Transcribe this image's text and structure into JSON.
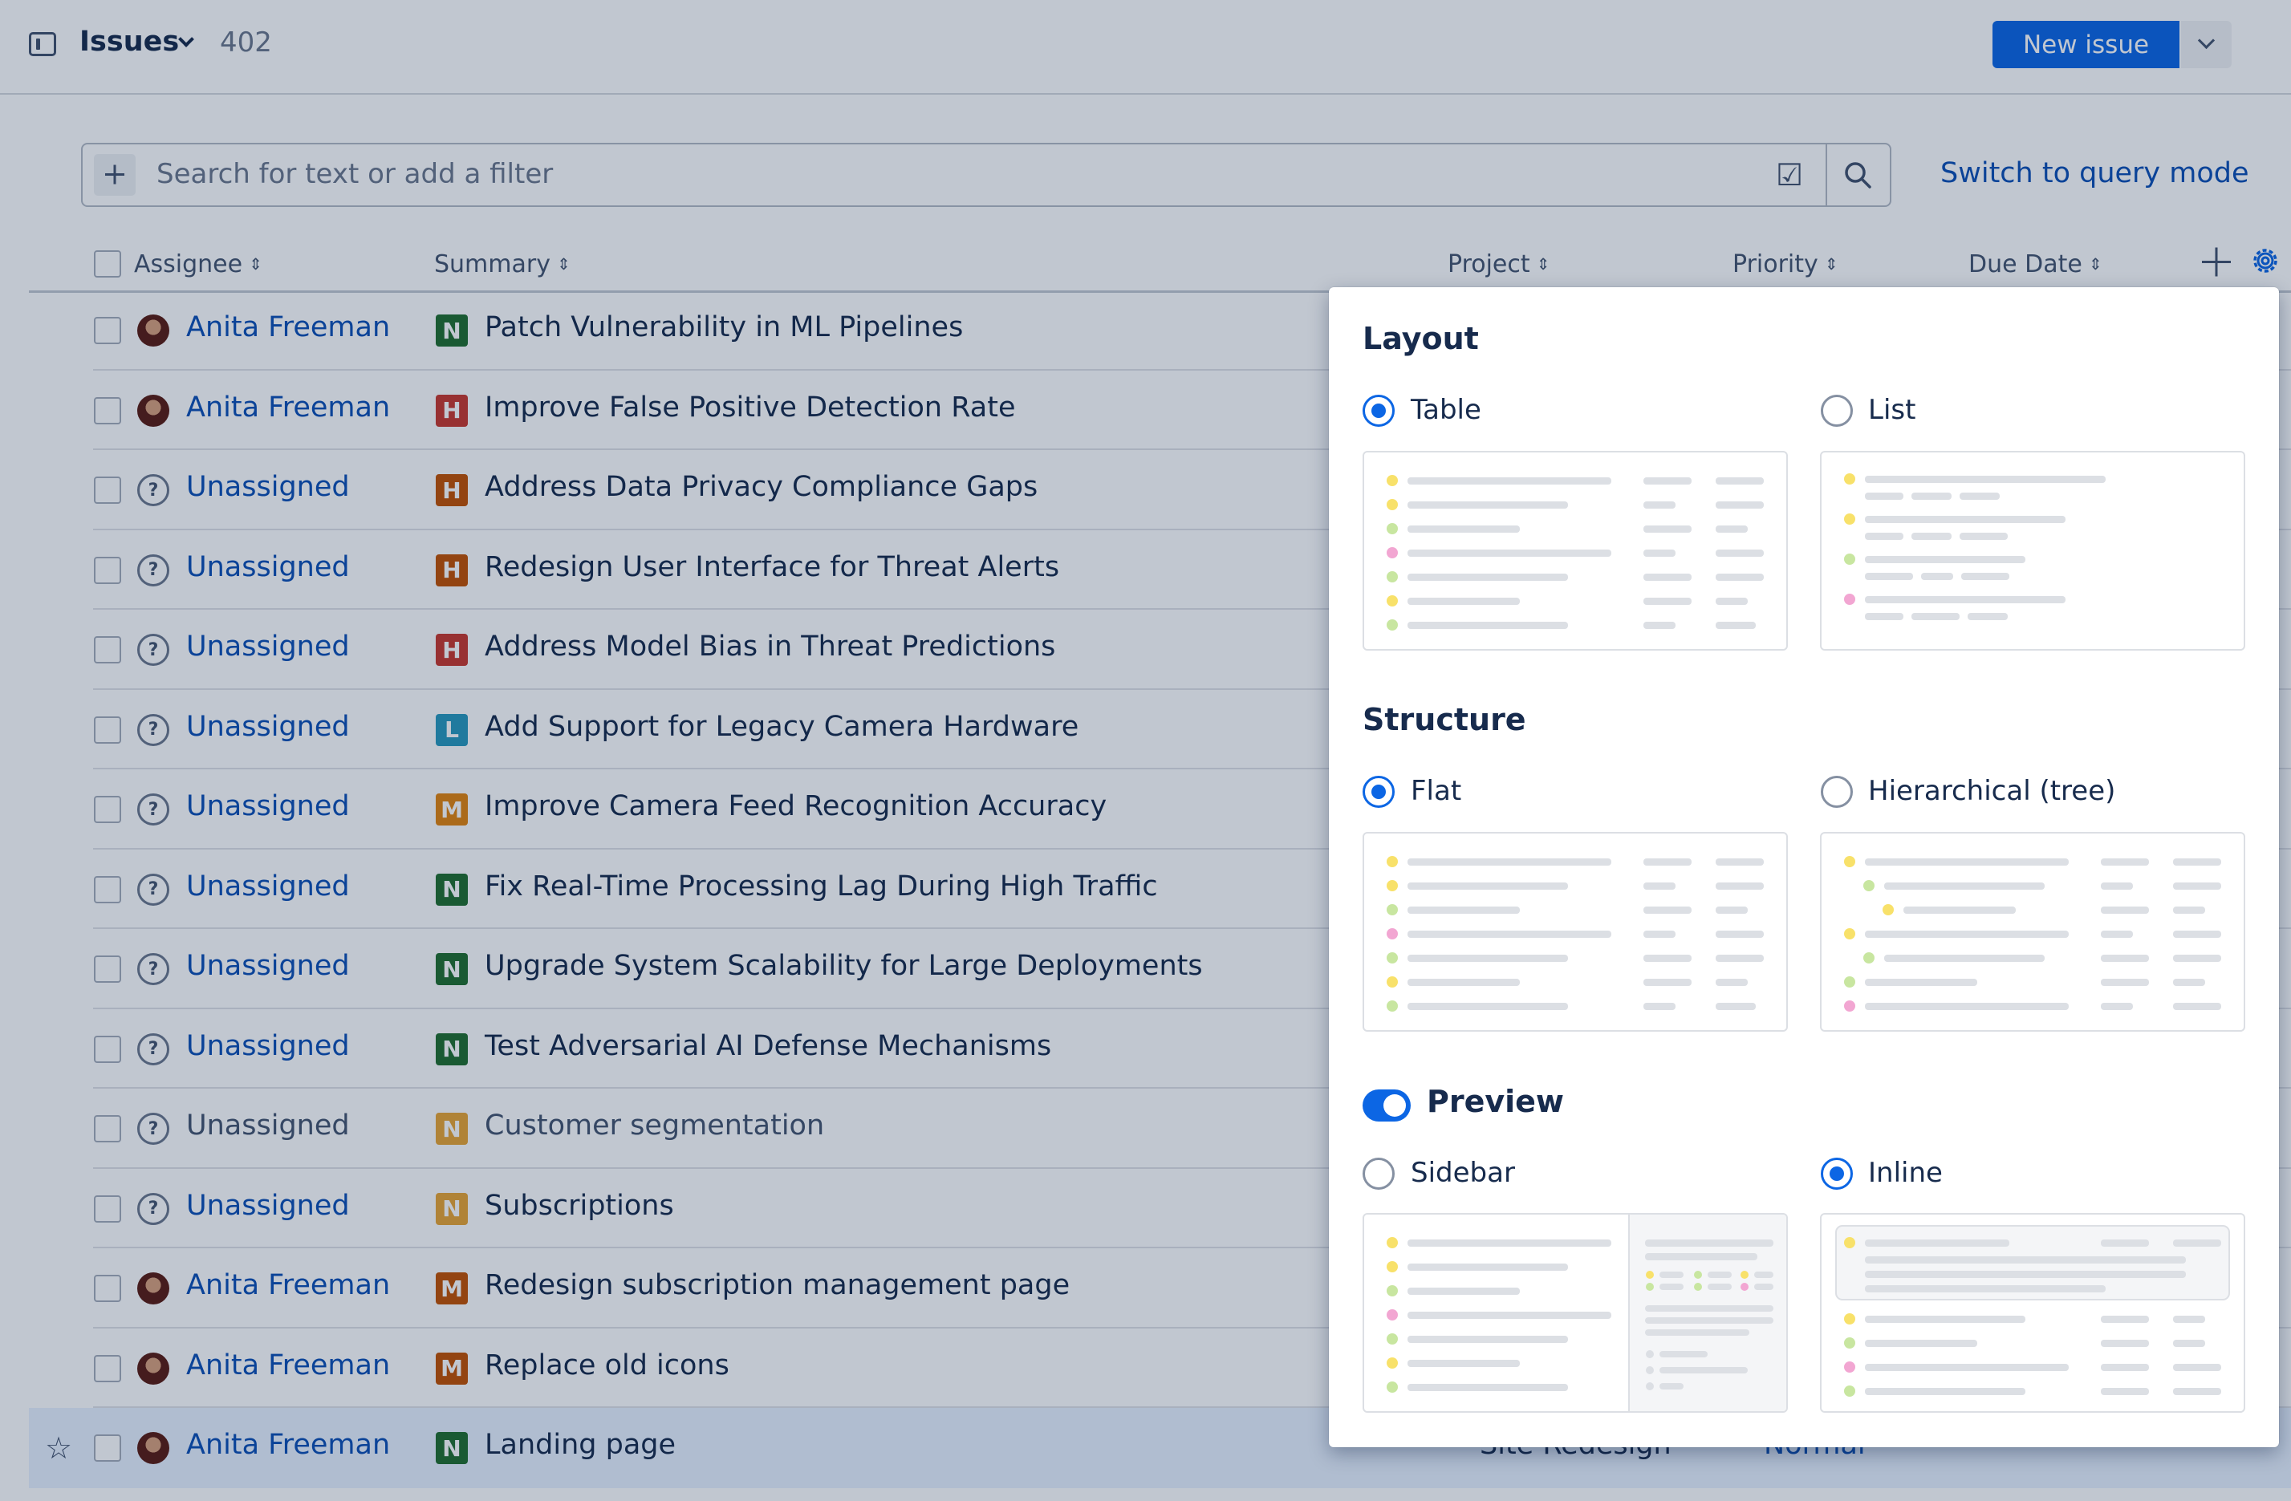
{
  "header": {
    "title": "Issues",
    "count": "402",
    "new_issue_label": "New issue"
  },
  "search": {
    "placeholder": "Search for text or add a filter",
    "switch_label": "Switch to query mode"
  },
  "columns": {
    "assignee": "Assignee",
    "summary": "Summary",
    "project": "Project",
    "priority": "Priority",
    "due_date": "Due Date"
  },
  "rows": [
    {
      "assignee": "Anita Freeman",
      "avatar": "person",
      "priority_letter": "N",
      "priority_color": "#216e2e",
      "summary": "Patch Vulnerability in ML Pipelines",
      "muted": false
    },
    {
      "assignee": "Anita Freeman",
      "avatar": "person",
      "priority_letter": "H",
      "priority_color": "#c9372c",
      "summary": "Improve False Positive Detection Rate",
      "muted": false
    },
    {
      "assignee": "Unassigned",
      "avatar": "unknown",
      "priority_letter": "H",
      "priority_color": "#c25100",
      "summary": "Address Data Privacy Compliance Gaps",
      "muted": false
    },
    {
      "assignee": "Unassigned",
      "avatar": "unknown",
      "priority_letter": "H",
      "priority_color": "#c25100",
      "summary": "Redesign User Interface for Threat Alerts",
      "muted": false
    },
    {
      "assignee": "Unassigned",
      "avatar": "unknown",
      "priority_letter": "H",
      "priority_color": "#c9372c",
      "summary": "Address Model Bias in Threat Predictions",
      "muted": false
    },
    {
      "assignee": "Unassigned",
      "avatar": "unknown",
      "priority_letter": "L",
      "priority_color": "#2898bd",
      "summary": "Add Support for Legacy Camera Hardware",
      "muted": false
    },
    {
      "assignee": "Unassigned",
      "avatar": "unknown",
      "priority_letter": "M",
      "priority_color": "#e2830c",
      "summary": "Improve Camera Feed Recognition Accuracy",
      "muted": false
    },
    {
      "assignee": "Unassigned",
      "avatar": "unknown",
      "priority_letter": "N",
      "priority_color": "#216e2e",
      "summary": "Fix Real-Time Processing Lag During High Traffic",
      "muted": false
    },
    {
      "assignee": "Unassigned",
      "avatar": "unknown",
      "priority_letter": "N",
      "priority_color": "#216e2e",
      "summary": "Upgrade System Scalability for Large Deployments",
      "muted": false
    },
    {
      "assignee": "Unassigned",
      "avatar": "unknown",
      "priority_letter": "N",
      "priority_color": "#216e2e",
      "summary": "Test Adversarial AI Defense Mechanisms",
      "muted": false
    },
    {
      "assignee": "Unassigned",
      "avatar": "unknown",
      "priority_letter": "N",
      "priority_color": "#e9a533",
      "summary": "Customer segmentation",
      "muted": true
    },
    {
      "assignee": "Unassigned",
      "avatar": "unknown",
      "priority_letter": "N",
      "priority_color": "#e9a533",
      "summary": "Subscriptions",
      "muted": false
    },
    {
      "assignee": "Anita Freeman",
      "avatar": "person",
      "priority_letter": "M",
      "priority_color": "#c25100",
      "summary": "Redesign subscription management page",
      "muted": false
    },
    {
      "assignee": "Anita Freeman",
      "avatar": "person",
      "priority_letter": "M",
      "priority_color": "#c25100",
      "summary": "Replace old icons",
      "muted": false
    },
    {
      "assignee": "Anita Freeman",
      "avatar": "person",
      "priority_letter": "N",
      "priority_color": "#216e2e",
      "summary": "Landing page",
      "muted": false,
      "selected": true,
      "project": "Site Redesign",
      "priority": "Normal"
    }
  ],
  "settings": {
    "layout": {
      "title": "Layout",
      "table": "Table",
      "list": "List",
      "selected": "table"
    },
    "structure": {
      "title": "Structure",
      "flat": "Flat",
      "tree": "Hierarchical (tree)",
      "selected": "flat"
    },
    "preview": {
      "title": "Preview",
      "enabled": true,
      "sidebar": "Sidebar",
      "inline": "Inline",
      "selected": "inline"
    }
  },
  "colors": {
    "accent": "#0c66e4",
    "link": "#0c4fb5",
    "dot_yellow": "#f8e16a",
    "dot_green": "#c8e6a0",
    "dot_pink": "#f2a6d2",
    "line_gray": "#dcdfe4"
  }
}
